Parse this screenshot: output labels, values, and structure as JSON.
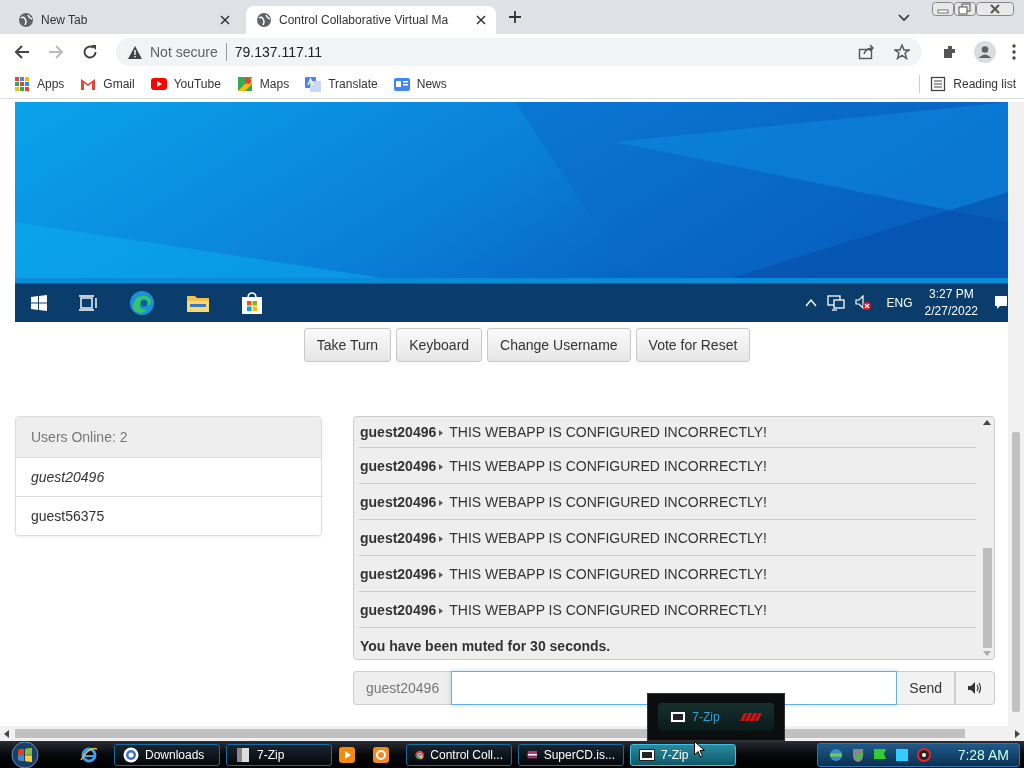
{
  "browser": {
    "tabs": [
      {
        "title": "New Tab",
        "selected": false
      },
      {
        "title": "Control Collaborative Virtual Ma",
        "selected": true
      }
    ],
    "security": "Not secure",
    "url": "79.137.117.11",
    "bookmarks": [
      {
        "label": "Apps"
      },
      {
        "label": "Gmail"
      },
      {
        "label": "YouTube"
      },
      {
        "label": "Maps"
      },
      {
        "label": "Translate"
      },
      {
        "label": "News"
      }
    ],
    "reading_list": "Reading list"
  },
  "vm_taskbar": {
    "language": "ENG",
    "time": "3:27 PM",
    "date": "2/27/2022"
  },
  "controls": [
    "Take Turn",
    "Keyboard",
    "Change Username",
    "Vote for Reset"
  ],
  "users": {
    "header": "Users Online: 2",
    "items": [
      {
        "name": "guest20496",
        "self": true
      },
      {
        "name": "guest56375",
        "self": false
      }
    ]
  },
  "chat": {
    "messages": [
      {
        "kind": "message",
        "user": "guest20496",
        "text": "THIS WEBAPP IS CONFIGURED INCORRECTLY!"
      },
      {
        "kind": "message",
        "user": "guest20496",
        "text": "THIS WEBAPP IS CONFIGURED INCORRECTLY!"
      },
      {
        "kind": "message",
        "user": "guest20496",
        "text": "THIS WEBAPP IS CONFIGURED INCORRECTLY!"
      },
      {
        "kind": "message",
        "user": "guest20496",
        "text": "THIS WEBAPP IS CONFIGURED INCORRECTLY!"
      },
      {
        "kind": "message",
        "user": "guest20496",
        "text": "THIS WEBAPP IS CONFIGURED INCORRECTLY!"
      },
      {
        "kind": "message",
        "user": "guest20496",
        "text": "THIS WEBAPP IS CONFIGURED INCORRECTLY!"
      },
      {
        "kind": "notice",
        "text": "You have been muted for 30 seconds."
      }
    ],
    "username": "guest20496",
    "send": "Send"
  },
  "taskbar": {
    "items": [
      {
        "kind": "launcher"
      },
      {
        "kind": "window",
        "label": "Downloads",
        "active": false
      },
      {
        "kind": "window",
        "label": "7-Zip",
        "active": false
      },
      {
        "kind": "launcher"
      },
      {
        "kind": "launcher"
      },
      {
        "kind": "window",
        "label": "Control Coll...",
        "active": false
      },
      {
        "kind": "window",
        "label": "SuperCD.is...",
        "active": false
      },
      {
        "kind": "window",
        "label": "7-Zip",
        "active": true
      }
    ],
    "time": "7:28 AM"
  },
  "thumbnail": {
    "title": "7-Zip"
  }
}
